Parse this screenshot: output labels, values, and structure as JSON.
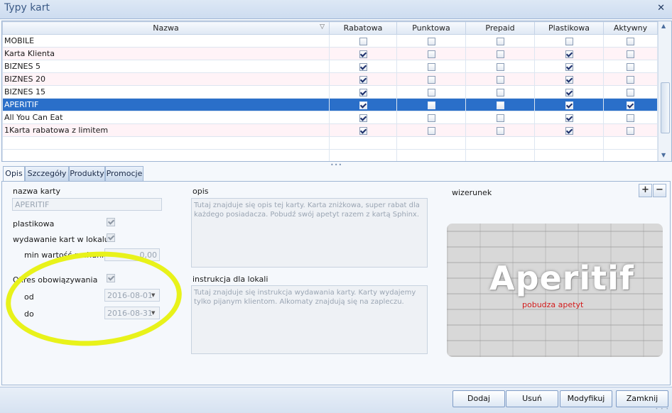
{
  "window": {
    "title": "Typy kart"
  },
  "grid": {
    "columns": [
      "Nazwa",
      "Rabatowa",
      "Punktowa",
      "Prepaid",
      "Plastikowa",
      "Aktywny"
    ],
    "rows": [
      {
        "name": "MOBILE",
        "checks": [
          false,
          false,
          false,
          false,
          false
        ]
      },
      {
        "name": "Karta Klienta",
        "checks": [
          true,
          false,
          false,
          true,
          false
        ]
      },
      {
        "name": "BIZNES 5",
        "checks": [
          true,
          false,
          false,
          true,
          false
        ]
      },
      {
        "name": "BIZNES 20",
        "checks": [
          true,
          false,
          false,
          true,
          false
        ]
      },
      {
        "name": "BIZNES 15",
        "checks": [
          true,
          false,
          false,
          true,
          false
        ]
      },
      {
        "name": "APERITIF",
        "checks": [
          true,
          false,
          false,
          true,
          true
        ],
        "selected": true
      },
      {
        "name": "All You Can Eat",
        "checks": [
          true,
          false,
          false,
          true,
          false
        ]
      },
      {
        "name": "1Karta rabatowa z limitem",
        "checks": [
          true,
          false,
          false,
          true,
          false
        ]
      }
    ]
  },
  "tabs": [
    "Opis",
    "Szczegóły",
    "Produkty",
    "Promocje"
  ],
  "form": {
    "name_label": "nazwa karty",
    "name_value": "APERITIF",
    "plastic_label": "plastikowa",
    "issue_label": "wydawanie kart w lokalu",
    "min_label": "min wartość rachunku",
    "min_value": "0,00",
    "period_label": "Okres obowiązywania",
    "from_label": "od",
    "from_value": "2016-08-01",
    "to_label": "do",
    "to_value": "2016-08-31",
    "desc_label": "opis",
    "desc_text": "Tutaj znajduje się opis tej karty. Karta zniżkowa, super rabat dla każdego posiadacza. Pobudź swój apetyt razem z kartą Sphinx.",
    "instr_label": "instrukcja dla lokali",
    "instr_text": "Tutaj znajduje się instrukcja wydawania karty. Karty wydajemy tylko pijanym klientom. Alkomaty znajdują się na zapleczu.",
    "image_label": "wizerunek",
    "logo_main": "Aperitif",
    "logo_sub": "pobudza apetyt"
  },
  "buttons": {
    "add": "Dodaj",
    "delete": "Usuń",
    "modify": "Modyfikuj",
    "close": "Zamknij"
  },
  "colors": {
    "selection": "#2a6fc9",
    "annotation": "#e8f21a"
  }
}
